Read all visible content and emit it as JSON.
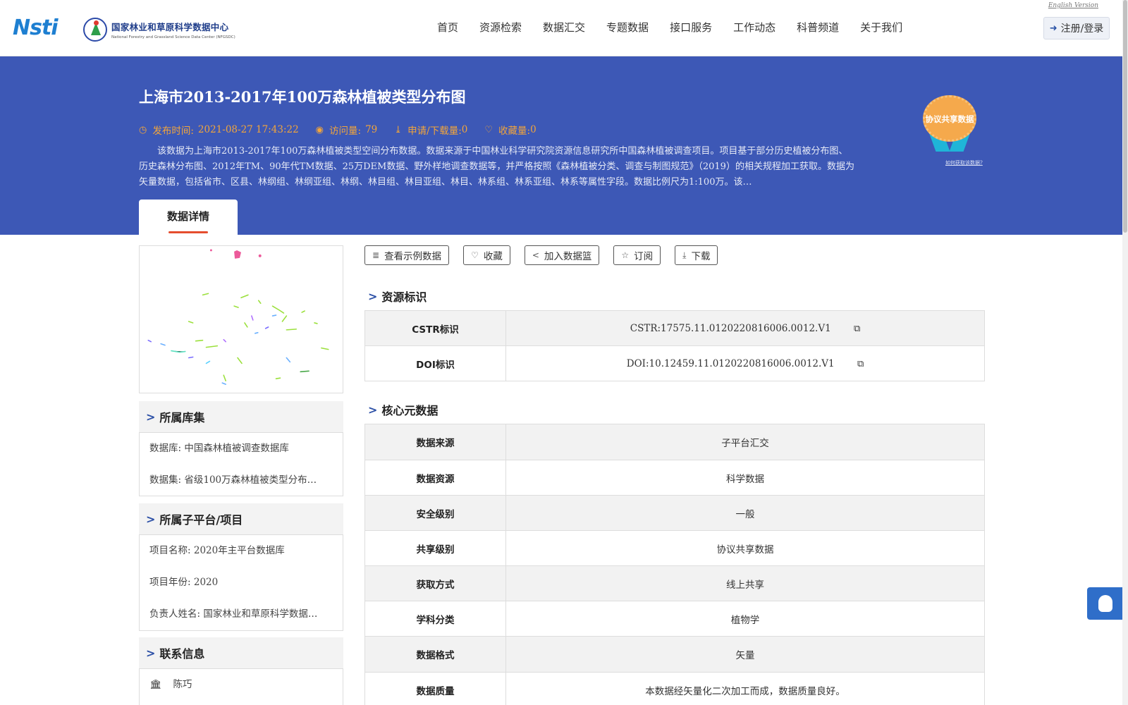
{
  "header": {
    "logo_nsti": "Nsti",
    "logo_cn": "国家林业和草原科学数据中心",
    "logo_en": "National Forestry and Grassland Science Data Center (NFGSDC)",
    "nav": [
      "首页",
      "资源检索",
      "数据汇交",
      "专题数据",
      "接口服务",
      "工作动态",
      "科普频道",
      "关于我们"
    ],
    "english_version": "English Version",
    "login_label": "注册/登录"
  },
  "banner": {
    "title": "上海市2013-2017年100万森林植被类型分布图",
    "publish_label": "发布时间:",
    "publish_value": "2021-08-27 17:43:22",
    "visits_label": "访问量:",
    "visits_value": "79",
    "downloads_label": "申请/下载量:",
    "downloads_value": "0",
    "favorites_label": "收藏量:",
    "favorites_value": "0",
    "description": "该数据为上海市2013-2017年100万森林植被类型空间分布数据。数据来源于中国林业科学研究院资源信息研究所中国森林植被调查项目。项目基于部分历史植被分布图、历史森林分布图、2012年TM、90年代TM数据、25万DEM数据、野外样地调查数据等，并严格按照《森林植被分类、调查与制图规范》（2019）的相关规程加工获取。数据为矢量数据，包括省市、区县、林纲组、林纲亚组、林纲、林目组、林目亚组、林目、林系组、林系亚组、林系等属性字段。数据比例尺为1:100万。该…",
    "badge_text": "协议共享数据",
    "badge_link": "如何获取该数据?",
    "tab_label": "数据详情"
  },
  "sidebar": {
    "library_title": "所属库集",
    "library_rows": [
      {
        "label": "数据库:",
        "value": "中国森林植被调查数据库"
      },
      {
        "label": "数据集:",
        "value": "省级100万森林植被类型分布…"
      }
    ],
    "project_title": "所属子平台/项目",
    "project_rows": [
      {
        "label": "项目名称:",
        "value": "2020年主平台数据库"
      },
      {
        "label": "项目年份:",
        "value": "2020"
      },
      {
        "label": "负责人姓名:",
        "value": "国家林业和草原科学数据…"
      }
    ],
    "contact_title": "联系信息",
    "contact_name": "陈巧"
  },
  "actions": [
    "查看示例数据",
    "收藏",
    "加入数据篮",
    "订阅",
    "下载"
  ],
  "resource_id": {
    "title": "资源标识",
    "rows": [
      {
        "key": "CSTR标识",
        "value": "CSTR:17575.11.0120220816006.0012.V1"
      },
      {
        "key": "DOI标识",
        "value": "DOI:10.12459.11.0120220816006.0012.V1"
      }
    ]
  },
  "core_metadata": {
    "title": "核心元数据",
    "rows": [
      {
        "key": "数据来源",
        "value": "子平台汇交"
      },
      {
        "key": "数据资源",
        "value": "科学数据"
      },
      {
        "key": "安全级别",
        "value": "一般"
      },
      {
        "key": "共享级别",
        "value": "协议共享数据"
      },
      {
        "key": "获取方式",
        "value": "线上共享"
      },
      {
        "key": "学科分类",
        "value": "植物学"
      },
      {
        "key": "数据格式",
        "value": "矢量"
      },
      {
        "key": "数据质量",
        "value": "本数据经矢量化二次加工而成，数据质量良好。"
      }
    ]
  },
  "colors": {
    "banner": "#3d58b6",
    "accent_orange": "#f2a53b",
    "tab_underline": "#e54d2e",
    "chevron": "#2b4fa6"
  }
}
